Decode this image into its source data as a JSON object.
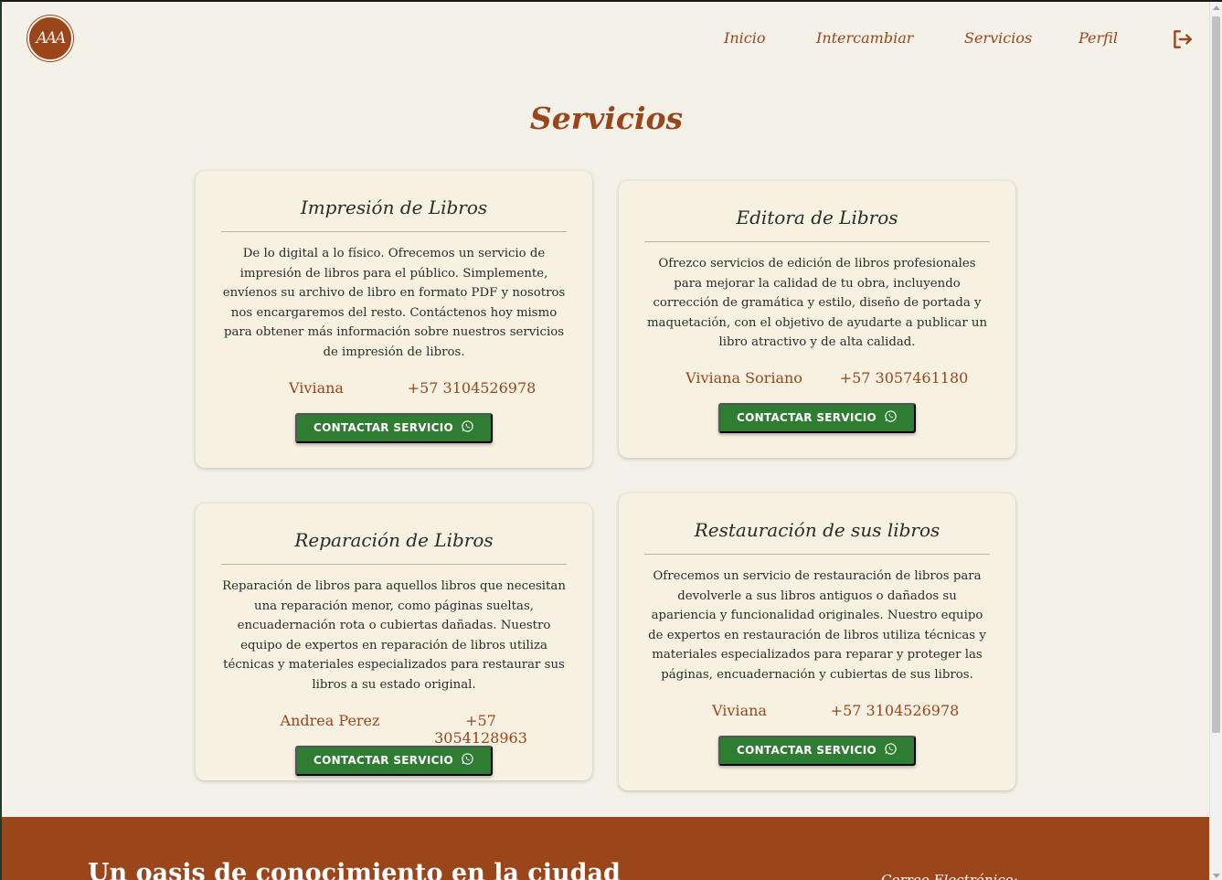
{
  "header": {
    "logo_text": "AAA",
    "nav": [
      "Inicio",
      "Intercambiar",
      "Servicios",
      "Perfil"
    ]
  },
  "page": {
    "title": "Servicios"
  },
  "services": [
    {
      "title": "Impresión de Libros",
      "description": "De lo digital a lo físico. Ofrecemos un servicio de impresión de libros para el público. Simplemente, envíenos su archivo de libro en formato PDF y nosotros nos encargaremos del resto. Contáctenos hoy mismo para obtener más información sobre nuestros servicios de impresión de libros.",
      "contact_name": "Viviana",
      "contact_phone": "+57 3104526978",
      "button": "CONTACTAR SERVICIO"
    },
    {
      "title": "Editora de Libros",
      "description": "Ofrezco servicios de edición de libros profesionales para mejorar la calidad de tu obra, incluyendo corrección de gramática y estilo, diseño de portada y maquetación, con el objetivo de ayudarte a publicar un libro atractivo y de alta calidad.",
      "contact_name": "Viviana Soriano",
      "contact_phone": "+57 3057461180",
      "button": "CONTACTAR SERVICIO"
    },
    {
      "title": "Reparación de Libros",
      "description": "Reparación de libros para aquellos libros que necesitan una reparación menor, como páginas sueltas, encuadernación rota o cubiertas dañadas. Nuestro equipo de expertos en reparación de libros utiliza técnicas y materiales especializados para restaurar sus libros a su estado original.",
      "contact_name": "Andrea Perez",
      "contact_phone": "+57 3054128963",
      "button": "CONTACTAR SERVICIO"
    },
    {
      "title": "Restauración de sus libros",
      "description": "Ofrecemos un servicio de restauración de libros para devolverle a sus libros antiguos o dañados su apariencia y funcionalidad originales. Nuestro equipo de expertos en restauración de libros utiliza técnicas y materiales especializados para reparar y proteger las páginas, encuadernación y cubiertas de sus libros.",
      "contact_name": "Viviana",
      "contact_phone": "+57 3104526978",
      "button": "CONTACTAR SERVICIO"
    }
  ],
  "footer": {
    "tagline": "Un oasis de conocimiento en la ciudad",
    "email_label": "Correo Electrónico:"
  },
  "colors": {
    "background": "#f4f1e8",
    "accent": "#9b451b",
    "card": "#f7f1e2",
    "button": "#2f7d32"
  },
  "icons": {
    "logout": "logout-icon",
    "whatsapp": "whatsapp-icon"
  }
}
